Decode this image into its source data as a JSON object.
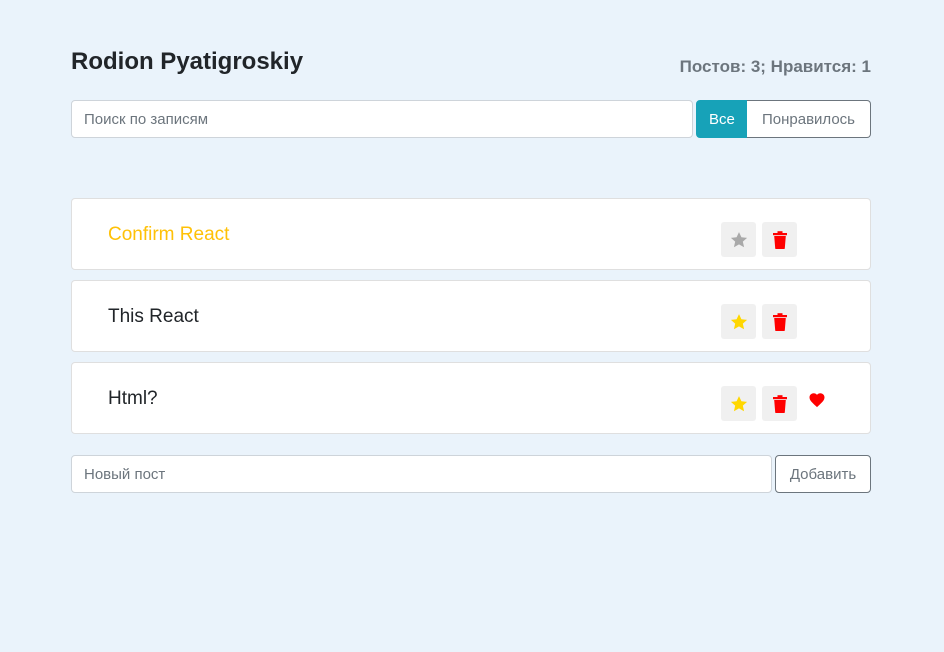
{
  "header": {
    "title": "Rodion Pyatigroskiy",
    "stats": "Постов: 3; Нравится: 1"
  },
  "search": {
    "placeholder": "Поиск по записям",
    "value": ""
  },
  "filter": {
    "all_label": "Все",
    "liked_label": "Понравилось",
    "active": "all"
  },
  "posts": [
    {
      "label": "Confirm React",
      "important": true,
      "liked": false
    },
    {
      "label": "This React",
      "important": false,
      "liked": false
    },
    {
      "label": "Html?",
      "important": false,
      "liked": true
    }
  ],
  "add_form": {
    "placeholder": "Новый пост",
    "value": "",
    "button_label": "Добавить"
  },
  "colors": {
    "background": "#eaf3fb",
    "accent": "#17a2b8",
    "important": "#ffc107",
    "star_inactive": "#a9a9a9",
    "star_active": "#ffd700",
    "trash": "#ff0000",
    "heart": "#ff0000"
  },
  "icons": {
    "star": "star-icon",
    "trash": "trash-icon",
    "heart": "heart-icon"
  }
}
